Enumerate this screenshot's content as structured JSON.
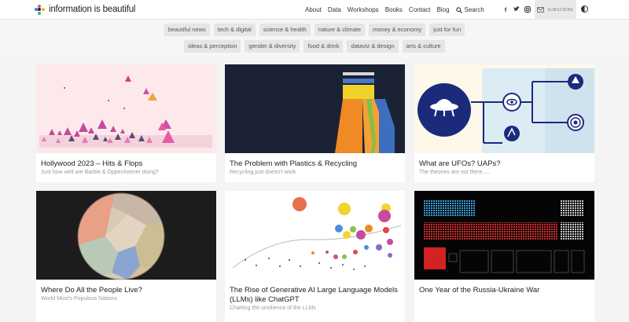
{
  "header": {
    "logo_text": "information is beautiful",
    "nav": [
      "About",
      "Data",
      "Workshops",
      "Books",
      "Contact",
      "Blog"
    ],
    "search_label": "Search",
    "socials": [
      "facebook-icon",
      "twitter-icon",
      "instagram-icon",
      "threads-icon",
      "rss-icon"
    ],
    "subscribe_label": "SUBSCRIBE"
  },
  "tags": {
    "row1": [
      "beautiful news",
      "tech & digital",
      "science & health",
      "nature & climate",
      "money & economy",
      "just for fun"
    ],
    "row2": [
      "ideas & perception",
      "gender & diversity",
      "food & drink",
      "dataviz & design",
      "arts & culture"
    ]
  },
  "cards": [
    {
      "title": "Hollywood 2023 – Hits & Flops",
      "subtitle": "Just how well are Barbie & Oppenheimer doing?"
    },
    {
      "title": "The Problem with Plastics & Recycling",
      "subtitle": "Recycling just doesn't work"
    },
    {
      "title": "What are UFOs? UAPs?",
      "subtitle": "The theories are out there....."
    },
    {
      "title": "Where Do All the People Live?",
      "subtitle": "World Most's Populous Nations"
    },
    {
      "title": "The Rise of Generative AI Large Language Models (LLMs) like ChatGPT",
      "subtitle": "Charting the unsilience of the LLMs"
    },
    {
      "title": "One Year of the Russia-Ukraine War",
      "subtitle": ""
    }
  ]
}
